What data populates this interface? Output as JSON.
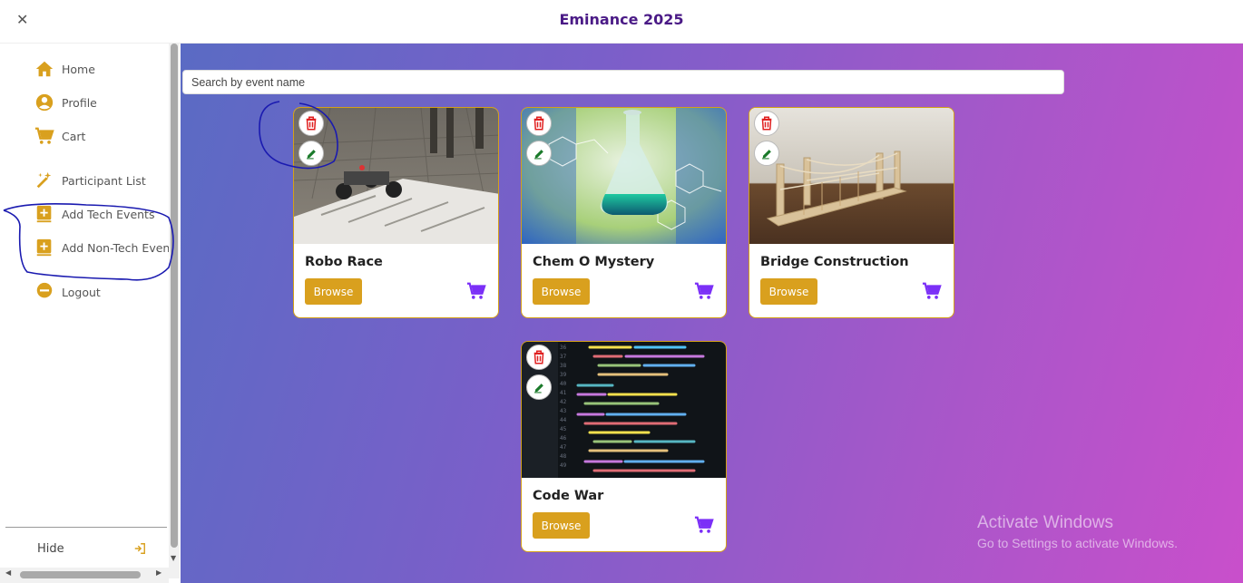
{
  "header": {
    "title": "Eminance 2025",
    "close_icon": "close-icon"
  },
  "sidebar": {
    "items": [
      {
        "label": "Home",
        "icon": "home-icon"
      },
      {
        "label": "Profile",
        "icon": "user-circle-icon"
      },
      {
        "label": "Cart",
        "icon": "cart-icon"
      },
      {
        "label": "Participant List",
        "icon": "magic-wand-icon"
      },
      {
        "label": "Add Tech Events",
        "icon": "add-box-icon"
      },
      {
        "label": "Add Non-Tech Events",
        "icon": "add-box-icon"
      },
      {
        "label": "Logout",
        "icon": "minus-circle-icon"
      }
    ],
    "hide_label": "Hide",
    "hide_icon": "exit-icon"
  },
  "search": {
    "placeholder": "Search by event name",
    "value": ""
  },
  "events": [
    {
      "title": "Robo Race",
      "browse_label": "Browse"
    },
    {
      "title": "Chem O Mystery",
      "browse_label": "Browse"
    },
    {
      "title": "Bridge Construction",
      "browse_label": "Browse"
    },
    {
      "title": "Code War",
      "browse_label": "Browse"
    }
  ],
  "watermark": {
    "line1": "Activate Windows",
    "line2": "Go to Settings to activate Windows."
  },
  "colors": {
    "accent": "#d9a01e",
    "title": "#4a1a86",
    "cart": "#7b2ff7",
    "delete": "#e02020",
    "edit": "#1a7a2a"
  }
}
